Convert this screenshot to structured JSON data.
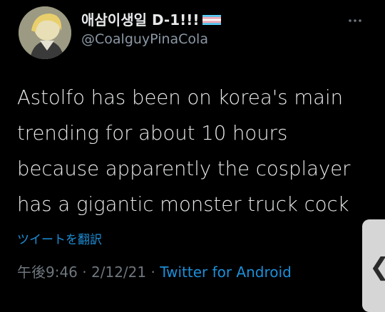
{
  "tweet": {
    "display_name": "애삼이생일 D-1!!!",
    "handle": "@CoalguyPinaCola",
    "text": "Astolfo has been on korea's main trending for about 10 hours because apparently the cosplayer has a gigantic monster truck cock",
    "translate_label": "ツイートを翻訳",
    "time": "午後9:46",
    "separator_1": " · ",
    "date": "2/12/21",
    "separator_2": " · ",
    "source": "Twitter for Android"
  },
  "ui": {
    "more_icon": "more-dots-icon",
    "side_tab_icon": "chevron-left-icon",
    "side_tab_glyph": "❮"
  },
  "colors": {
    "background": "#000000",
    "text": "#e7e9ea",
    "secondary": "#6e767d",
    "link": "#1d8fd8"
  }
}
